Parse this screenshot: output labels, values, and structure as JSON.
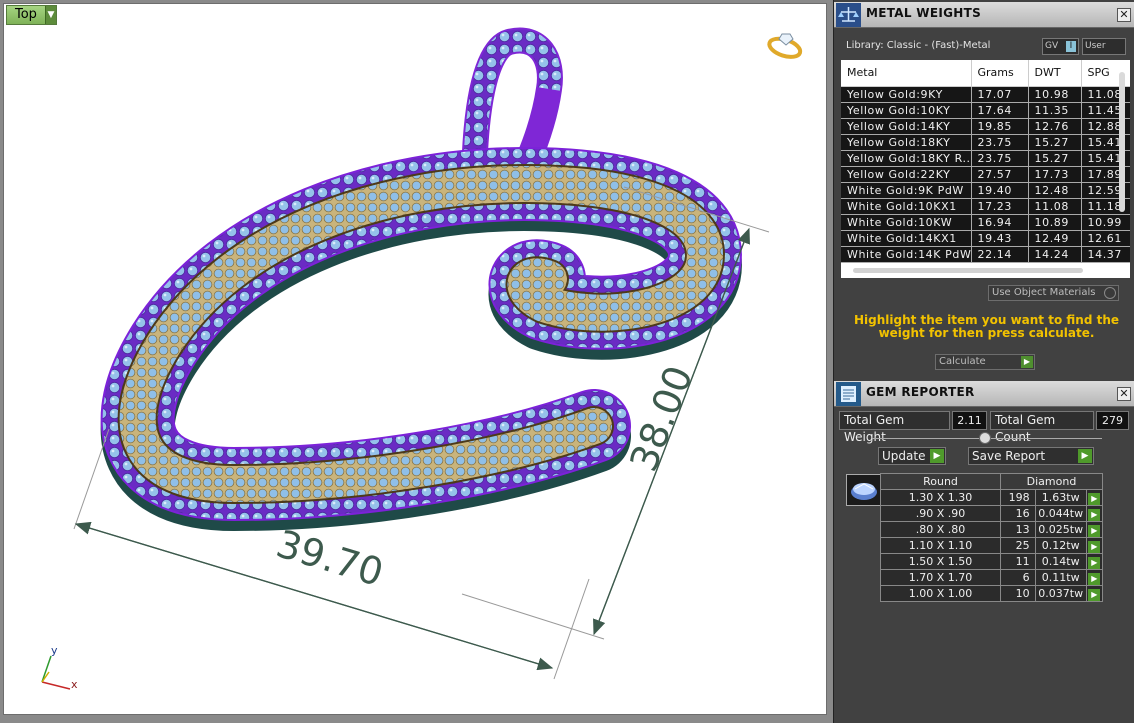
{
  "viewport": {
    "view_label": "Top",
    "dim_width": "39.70",
    "dim_height": "38.00",
    "axis_y": "y",
    "axis_x": "x"
  },
  "metal_weights": {
    "title": "METAL WEIGHTS",
    "library": "Library: Classic - (Fast)-Metal",
    "toggle_gv": "GV",
    "toggle_user": "User",
    "columns": [
      "Metal",
      "Grams",
      "DWT",
      "SPG"
    ],
    "rows": [
      [
        "Yellow Gold:9KY",
        "17.07",
        "10.98",
        "11.08"
      ],
      [
        "Yellow Gold:10KY",
        "17.64",
        "11.35",
        "11.45"
      ],
      [
        "Yellow Gold:14KY",
        "19.85",
        "12.76",
        "12.88"
      ],
      [
        "Yellow Gold:18KY",
        "23.75",
        "15.27",
        "15.41"
      ],
      [
        "Yellow Gold:18KY R...",
        "23.75",
        "15.27",
        "15.41"
      ],
      [
        "Yellow Gold:22KY",
        "27.57",
        "17.73",
        "17.89"
      ],
      [
        "White Gold:9K PdW",
        "19.40",
        "12.48",
        "12.59"
      ],
      [
        "White Gold:10KX1",
        "17.23",
        "11.08",
        "11.18"
      ],
      [
        "White Gold:10KW",
        "16.94",
        "10.89",
        "10.99"
      ],
      [
        "White Gold:14KX1",
        "19.43",
        "12.49",
        "12.61"
      ],
      [
        "White Gold:14K PdW",
        "22.14",
        "14.24",
        "14.37"
      ]
    ],
    "use_object_materials": "Use Object Materials",
    "hint": "Highlight the item you want to find the weight for then press calculate.",
    "calculate": "Calculate"
  },
  "gem_reporter": {
    "title": "GEM REPORTER",
    "total_weight_label": "Total Gem Weight",
    "total_weight_value": "2.11",
    "total_count_label": "Total Gem Count",
    "total_count_value": "279",
    "update_label": "Update",
    "save_report_label": "Save Report",
    "col_shape": "Round",
    "col_type": "Diamond",
    "gems": [
      [
        "1.30 X 1.30",
        "198",
        "1.63tw"
      ],
      [
        ".90 X .90",
        "16",
        "0.044tw"
      ],
      [
        ".80 X .80",
        "13",
        "0.025tw"
      ],
      [
        "1.10 X 1.10",
        "25",
        "0.12tw"
      ],
      [
        "1.50 X 1.50",
        "11",
        "0.14tw"
      ],
      [
        "1.70 X 1.70",
        "6",
        "0.11tw"
      ],
      [
        "1.00 X 1.00",
        "10",
        "0.037tw"
      ]
    ]
  },
  "colors": {
    "metal": "#7b2fd0",
    "gem": "#8fbfe8",
    "gold": "#d8c08a",
    "dimension": "#3d5a4d",
    "highlight": "#f2c200"
  }
}
